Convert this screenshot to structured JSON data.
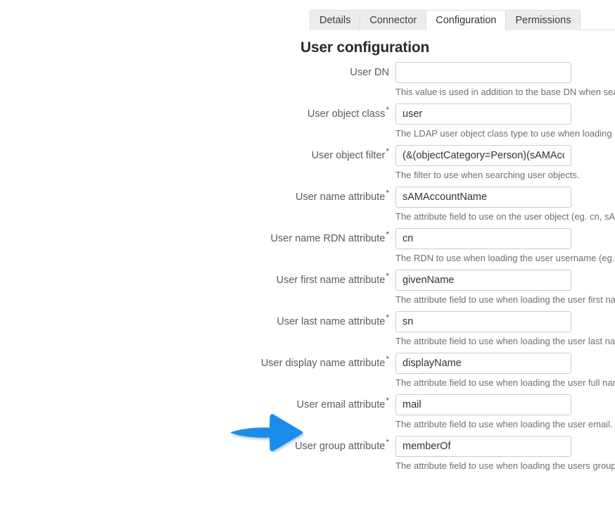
{
  "tabs": [
    {
      "label": "Details",
      "active": false
    },
    {
      "label": "Connector",
      "active": false
    },
    {
      "label": "Configuration",
      "active": true
    },
    {
      "label": "Permissions",
      "active": false
    }
  ],
  "section": {
    "title": "User configuration"
  },
  "colors": {
    "arrow": "#1f8ceb",
    "required_asterisk": "#8a3a35",
    "label_text": "#5b5b5b",
    "help_text": "#6f6f6f",
    "input_border": "#cccccc",
    "tab_inactive_bg": "#ececec",
    "tab_border": "#dddddd"
  },
  "fields": [
    {
      "label": "User DN",
      "required": false,
      "value": "",
      "help": "This value is used in addition to the base DN when searc"
    },
    {
      "label": "User object class",
      "required": true,
      "value": "user",
      "help": "The LDAP user object class type to use when loading use"
    },
    {
      "label": "User object filter",
      "required": true,
      "value": "(&(objectCategory=Person)(sAMAccountName=*))",
      "help": "The filter to use when searching user objects."
    },
    {
      "label": "User name attribute",
      "required": true,
      "value": "sAMAccountName",
      "help": "The attribute field to use on the user object (eg. cn, sAMA"
    },
    {
      "label": "User name RDN attribute",
      "required": true,
      "value": "cn",
      "help": "The RDN to use when loading the user username (eg. cn"
    },
    {
      "label": "User first name attribute",
      "required": true,
      "value": "givenName",
      "help": "The attribute field to use when loading the user first name"
    },
    {
      "label": "User last name attribute",
      "required": true,
      "value": "sn",
      "help": "The attribute field to use when loading the user last name"
    },
    {
      "label": "User display name attribute",
      "required": true,
      "value": "displayName",
      "help": "The attribute field to use when loading the user full name."
    },
    {
      "label": "User email attribute",
      "required": true,
      "value": "mail",
      "help": "The attribute field to use when loading the user email."
    },
    {
      "label": "User group attribute",
      "required": true,
      "value": "memberOf",
      "help": "The attribute field to use when loading the users groups."
    }
  ],
  "annotation": {
    "type": "arrow",
    "direction": "right",
    "points_to": "User email attribute"
  }
}
